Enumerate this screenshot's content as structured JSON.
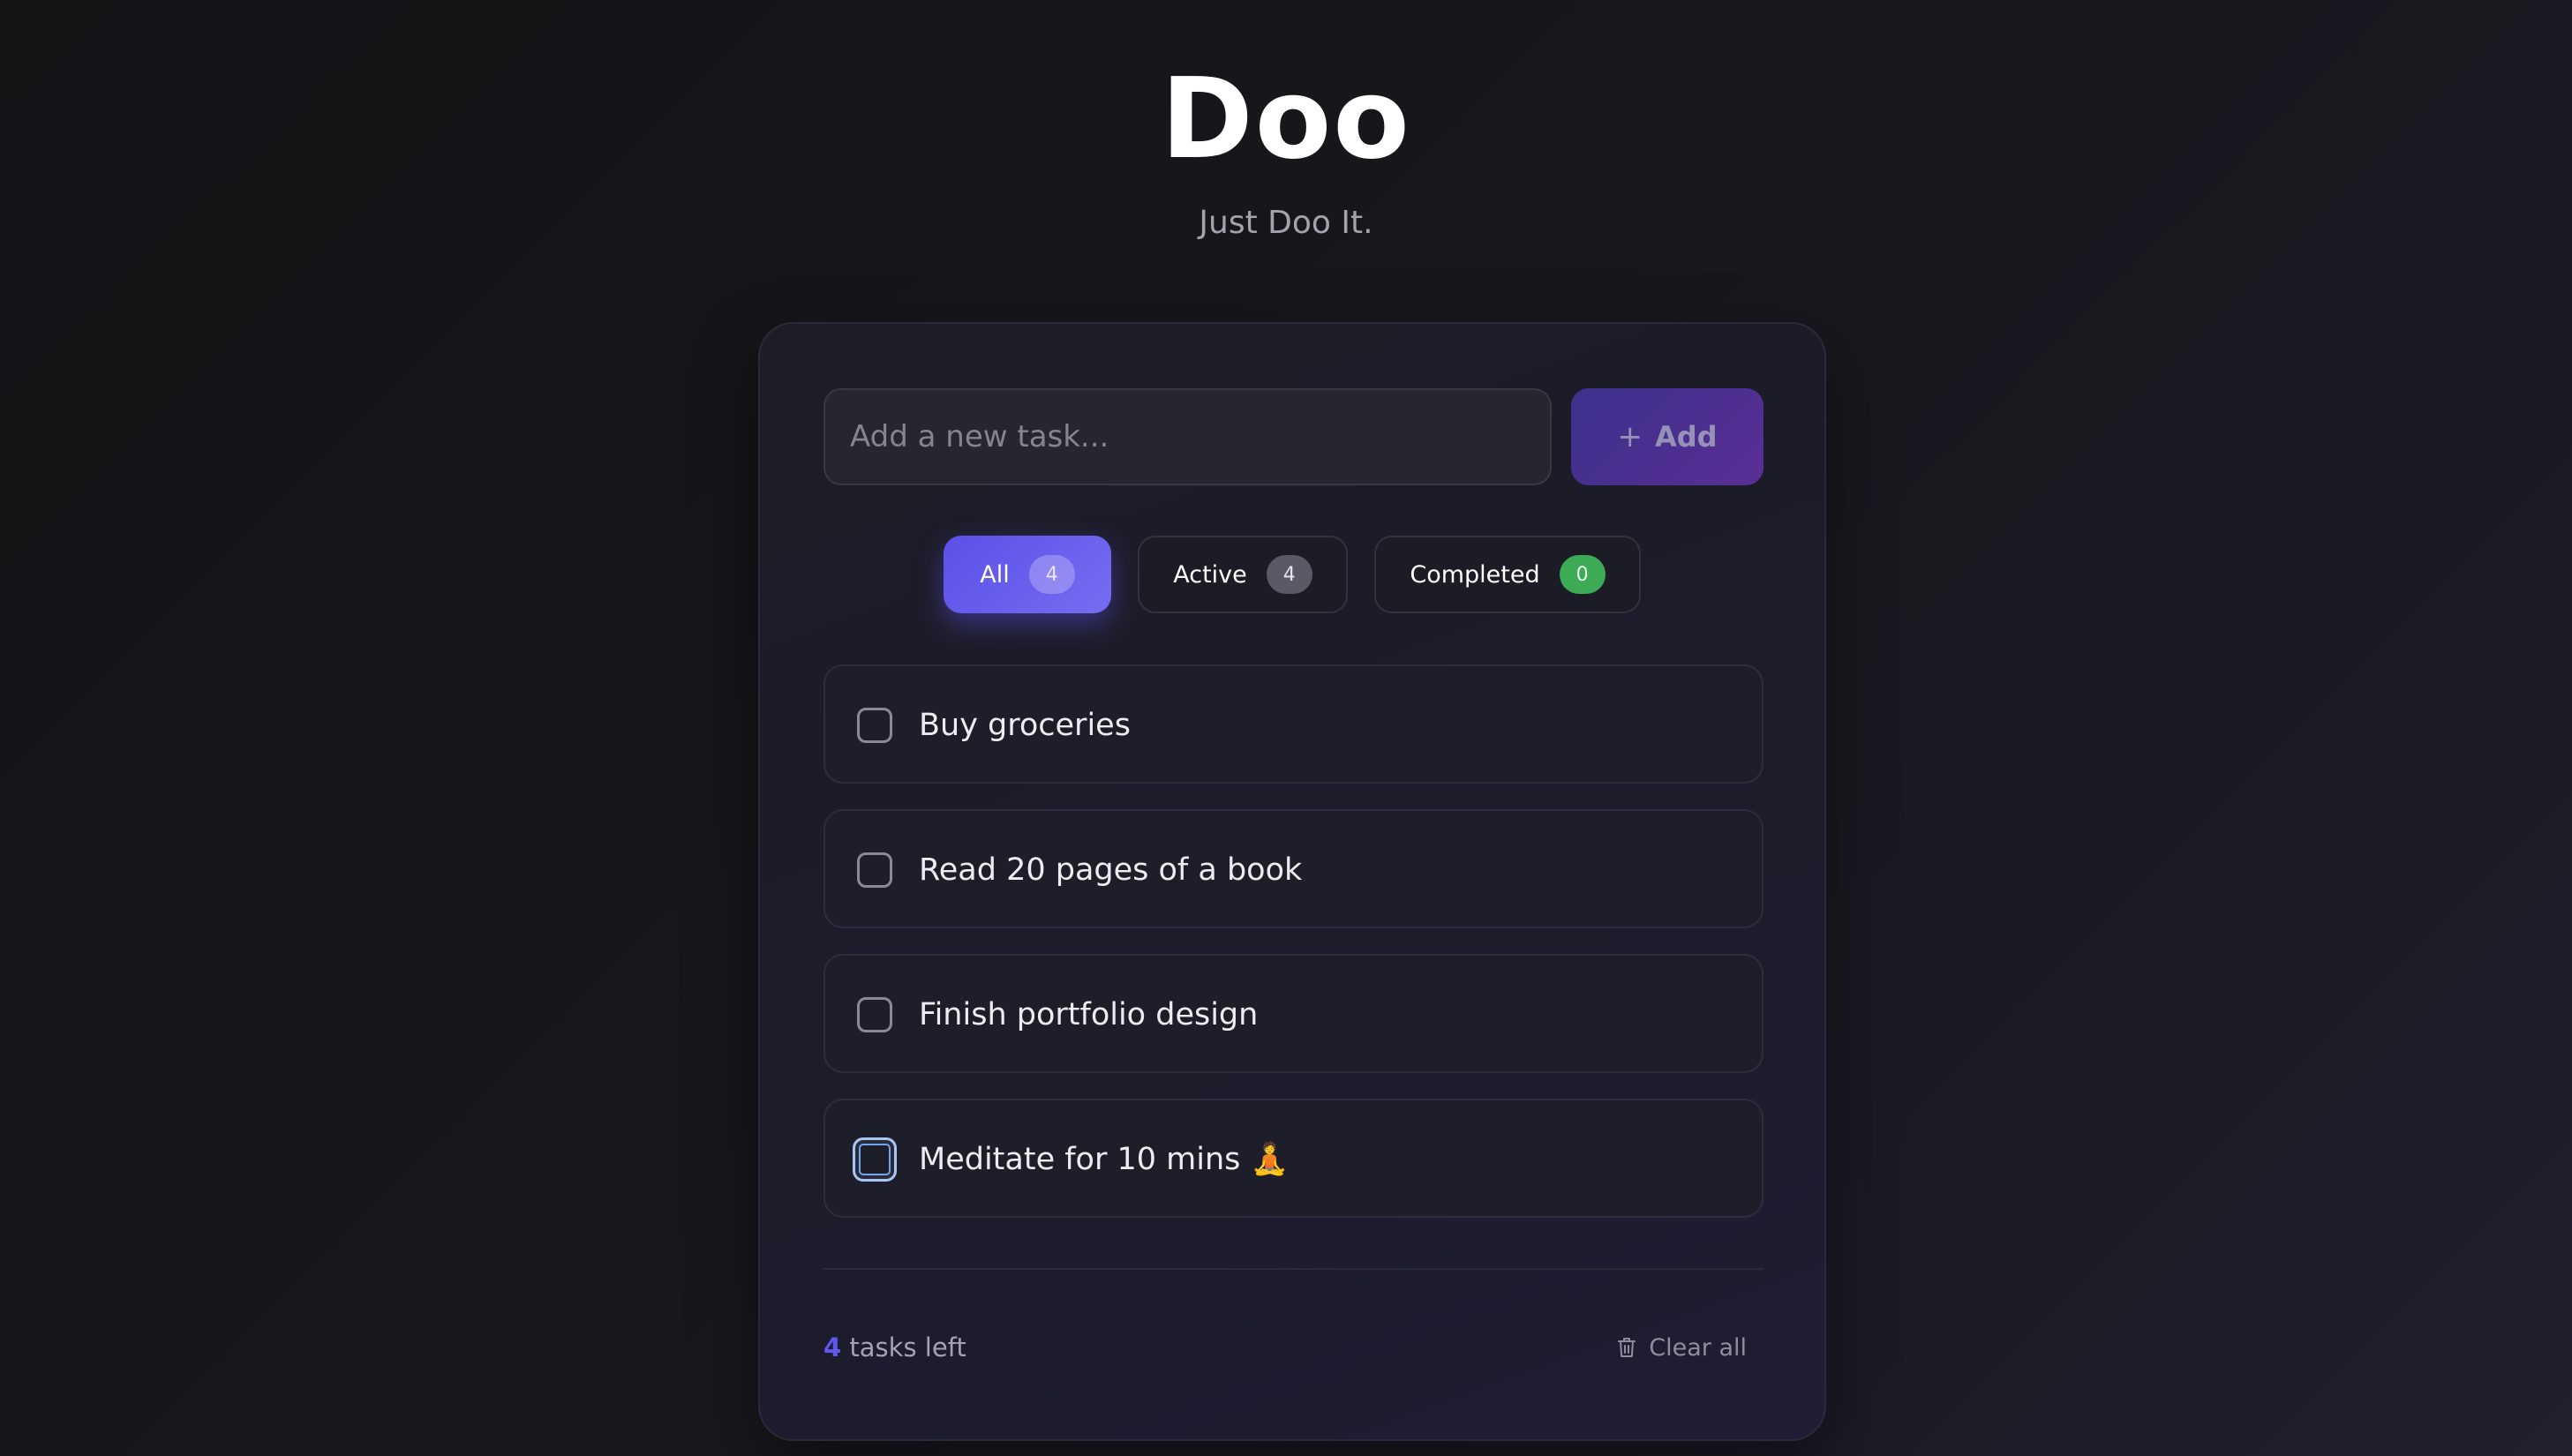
{
  "header": {
    "title": "Doo",
    "subtitle": "Just Doo It."
  },
  "new_task": {
    "placeholder": "Add a new task...",
    "value": "",
    "add_label": "Add",
    "add_icon": "plus-icon"
  },
  "filters": {
    "selected": "All",
    "tabs": [
      {
        "label": "All",
        "count": "4"
      },
      {
        "label": "Active",
        "count": "4"
      },
      {
        "label": "Completed",
        "count": "0"
      }
    ]
  },
  "tasks": [
    {
      "text": "Buy groceries",
      "completed": false
    },
    {
      "text": "Read 20 pages of a book",
      "completed": false
    },
    {
      "text": "Finish portfolio design",
      "completed": false
    },
    {
      "text": "Meditate for 10 mins 🧘",
      "completed": false,
      "focused": true
    }
  ],
  "footer": {
    "tasks_left_count": "4",
    "tasks_left_label": "tasks left",
    "clear_all_label": "Clear all",
    "clear_all_icon": "trash-icon"
  },
  "colors": {
    "accent": "#5b50e8",
    "completed_badge": "#3daa55",
    "background": "#17171c"
  }
}
